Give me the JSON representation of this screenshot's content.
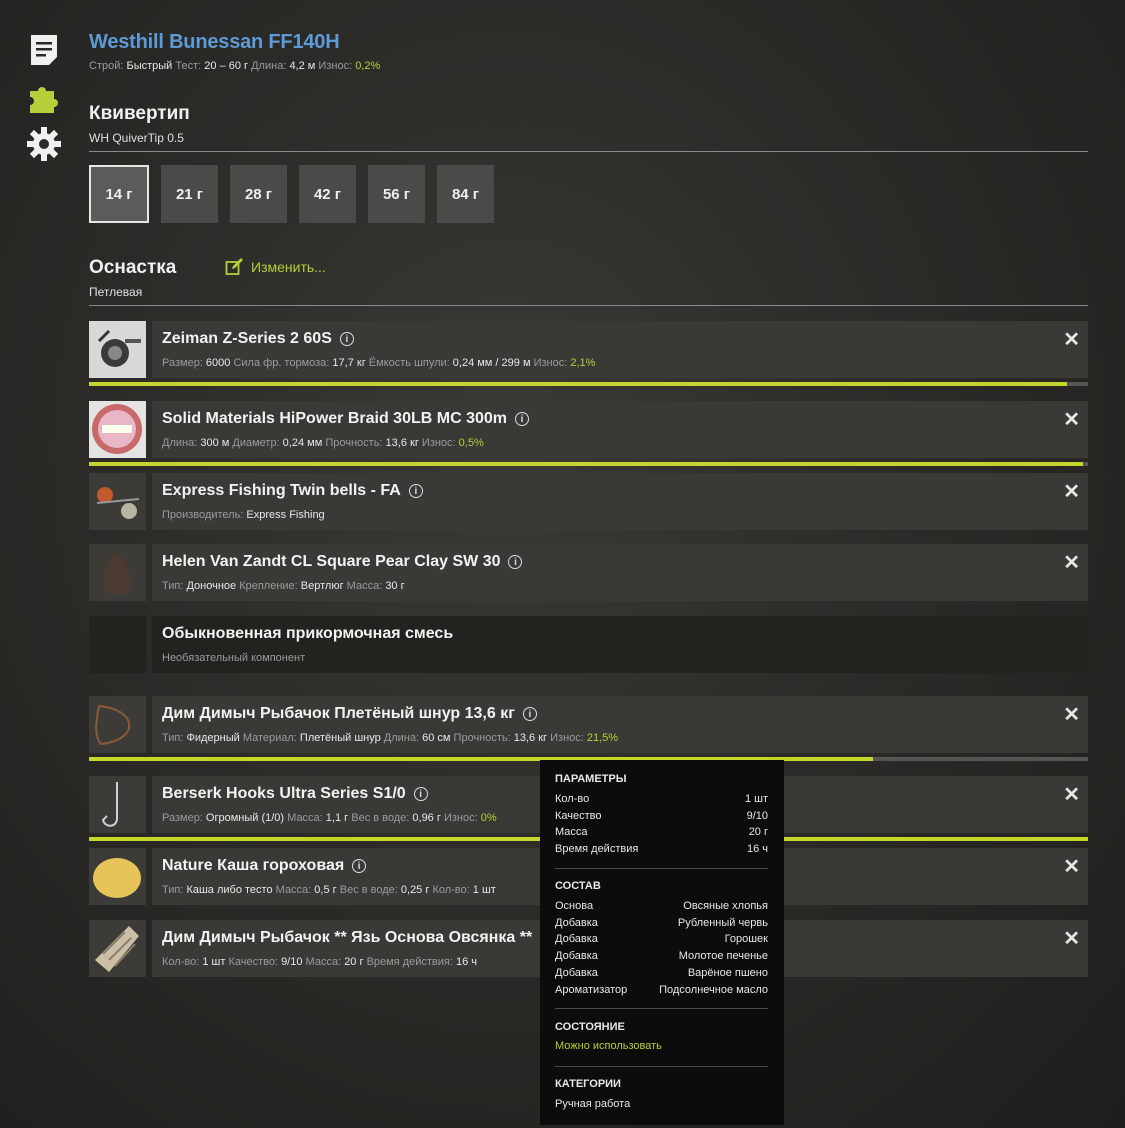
{
  "rod": {
    "title": "Westhill Bunessan FF140H",
    "stats": [
      {
        "label": "Строй:",
        "value": "Быстрый"
      },
      {
        "label": "Тест:",
        "value": "20 – 60 г"
      },
      {
        "label": "Длина:",
        "value": "4,2 м"
      },
      {
        "label": "Износ:",
        "value": "0,2%",
        "green": true
      }
    ]
  },
  "quivertip": {
    "title": "Квивертип",
    "subtitle": "WH QuiverTip 0.5",
    "tips": [
      "14 г",
      "21 г",
      "28 г",
      "42 г",
      "56 г",
      "84 г"
    ],
    "selected": 0
  },
  "tackle": {
    "title": "Оснастка",
    "subtitle": "Петлевая",
    "change_label": "Изменить..."
  },
  "items": [
    {
      "name": "Zeiman Z-Series 2 60S",
      "info": true,
      "close": true,
      "icon": "reel-icon",
      "stats": [
        [
          "Размер:",
          "6000"
        ],
        [
          "Сила фр. тормоза:",
          "17,7 кг"
        ],
        [
          "Ёмкость шпули:",
          "0,24 мм / 299 м"
        ],
        [
          "Износ:",
          "2,1%",
          true
        ]
      ],
      "bar": 0.979
    },
    {
      "name": "Solid Materials HiPower Braid 30LB MC 300m",
      "info": true,
      "close": true,
      "icon": "line-spool-icon",
      "stats": [
        [
          "Длина:",
          "300 м"
        ],
        [
          "Диаметр:",
          "0,24 мм"
        ],
        [
          "Прочность:",
          "13,6 кг"
        ],
        [
          "Износ:",
          "0,5%",
          true
        ]
      ],
      "bar": 0.995
    },
    {
      "name": "Express Fishing Twin bells - FA",
      "info": true,
      "close": true,
      "icon": "bells-icon",
      "stats": [
        [
          "Производитель:",
          "Express Fishing"
        ]
      ]
    },
    {
      "name": "Helen Van Zandt CL Square Pear Clay SW 30",
      "info": true,
      "close": true,
      "icon": "sinker-icon",
      "stats": [
        [
          "Тип:",
          "Доночное"
        ],
        [
          "Крепление:",
          "Вертлюг"
        ],
        [
          "Масса:",
          "30 г"
        ]
      ]
    },
    {
      "name": "Обыкновенная прикормочная смесь",
      "info": false,
      "close": false,
      "dark": true,
      "icon": "empty-slot",
      "stats": [
        [
          "Необязательный компонент",
          ""
        ]
      ]
    },
    {
      "name": "Дим Димыч Рыбачок Плетёный шнур 13,6 кг",
      "info": true,
      "close": true,
      "icon": "leader-icon",
      "stats": [
        [
          "Тип:",
          "Фидерный"
        ],
        [
          "Материал:",
          "Плетёный шнур"
        ],
        [
          "Длина:",
          "60 см"
        ],
        [
          "Прочность:",
          "13,6 кг"
        ],
        [
          "Износ:",
          "21,5%",
          true
        ]
      ],
      "bar": 0.785
    },
    {
      "name": "Berserk Hooks Ultra Series S1/0",
      "info": true,
      "close": true,
      "icon": "hook-icon",
      "stats": [
        [
          "Размер:",
          "Огромный (1/0)"
        ],
        [
          "Масса:",
          "1,1 г"
        ],
        [
          "Вес в воде:",
          "0,96 г"
        ],
        [
          "Износ:",
          "0%",
          true
        ]
      ],
      "bar": 1.0
    },
    {
      "name": "Nature Каша гороховая",
      "info": true,
      "close": true,
      "icon": "bait-icon",
      "stats": [
        [
          "Тип:",
          "Каша либо тесто"
        ],
        [
          "Масса:",
          "0,5 г"
        ],
        [
          "Вес в воде:",
          "0,25 г"
        ],
        [
          "Кол-во:",
          "1 шт"
        ]
      ]
    },
    {
      "name": "Дим Димыч Рыбачок ** Язь Основа Овсянка **",
      "info": true,
      "close": true,
      "icon": "feeder-bag-icon",
      "stats": [
        [
          "Кол-во:",
          "1 шт"
        ],
        [
          "Качество:",
          "9/10"
        ],
        [
          "Масса:",
          "20 г"
        ],
        [
          "Время действия:",
          "16 ч"
        ]
      ]
    }
  ],
  "tooltip": {
    "params_title": "ПАРАМЕТРЫ",
    "params": [
      [
        "Кол-во",
        "1 шт"
      ],
      [
        "Качество",
        "9/10"
      ],
      [
        "Масса",
        "20 г"
      ],
      [
        "Время действия",
        "16 ч"
      ]
    ],
    "composition_title": "СОСТАВ",
    "composition": [
      [
        "Основа",
        "Овсяные хлопья"
      ],
      [
        "Добавка",
        "Рубленный червь"
      ],
      [
        "Добавка",
        "Горошек"
      ],
      [
        "Добавка",
        "Молотое печенье"
      ],
      [
        "Добавка",
        "Варёное пшено"
      ],
      [
        "Ароматизатор",
        "Подсолнечное масло"
      ]
    ],
    "state_title": "СОСТОЯНИЕ",
    "state_value": "Можно использовать",
    "categories_title": "КАТЕГОРИИ",
    "categories_value": "Ручная работа"
  },
  "colors": {
    "accent": "#b7cf3a",
    "title_blue": "#5d9ad6",
    "bar": "#c6d52b"
  }
}
